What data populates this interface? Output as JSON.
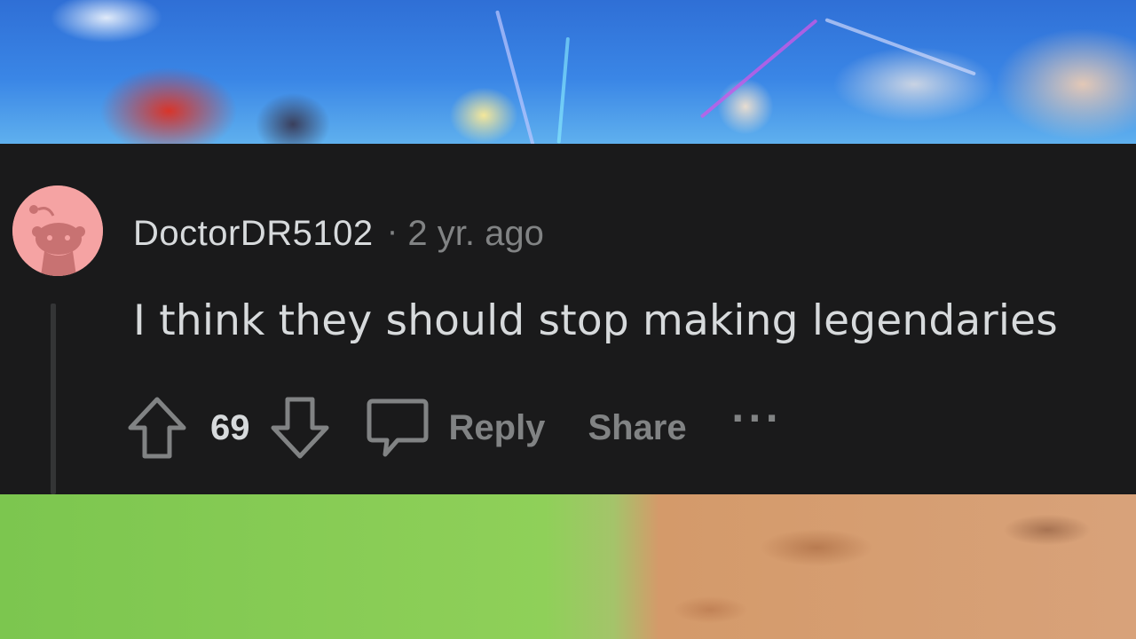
{
  "comment": {
    "username": "DoctorDR5102",
    "separator": "·",
    "timestamp": "2 yr. ago",
    "body": "I think they should stop making legendaries",
    "score": "69",
    "actions": {
      "reply_label": "Reply",
      "share_label": "Share",
      "more_label": "···"
    }
  },
  "icons": {
    "avatar": "reddit-snoo-avatar-icon",
    "upvote": "upvote-arrow-icon",
    "downvote": "downvote-arrow-icon",
    "reply": "comment-bubble-icon"
  },
  "colors": {
    "card_background": "#1a1a1b",
    "text_primary": "#d7dadc",
    "text_secondary": "#818384",
    "avatar_background": "#f5a3a3",
    "thread_line": "#343536"
  }
}
